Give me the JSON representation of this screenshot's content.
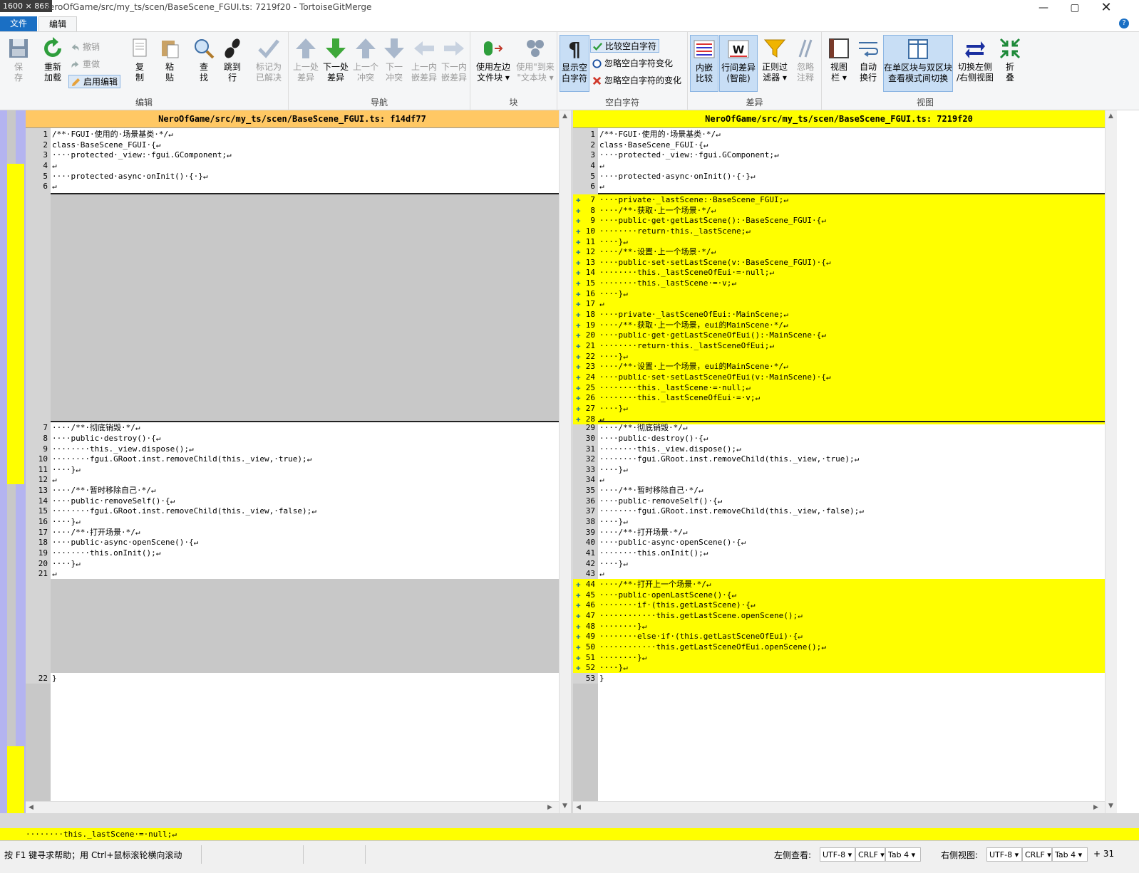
{
  "window": {
    "dimensions_label": "1600 × 868",
    "title": "NeroOfGame/src/my_ts/scen/BaseScene_FGUI.ts: 7219f20 - TortoiseGitMerge"
  },
  "ribbon_tabs": [
    "文件",
    "编辑"
  ],
  "help_label": "?",
  "ribbon": {
    "edit_group": {
      "label": "编辑",
      "save": "保\n存",
      "reload": "重新\n加载",
      "undo": "撤销",
      "redo": "重做",
      "enable_edit": "启用编辑",
      "copy": "复\n制",
      "paste": "粘\n贴",
      "find": "查\n找",
      "goto": "跳到\n行",
      "mark_resolved": "标记为\n已解决"
    },
    "nav_group": {
      "label": "导航",
      "prev_diff": "上一处\n差异",
      "next_diff": "下一处\n差异",
      "prev_conflict": "上一个\n冲突",
      "next_conflict": "下一\n冲突",
      "prev_inline": "上一内\n嵌差异",
      "next_inline": "下一内\n嵌差异"
    },
    "block_group": {
      "label": "块",
      "use_left": "使用左边\n文件块 ▾",
      "use_text": "使用\"到来\n\"文本块 ▾"
    },
    "whitespace_group": {
      "label": "空白字符",
      "show_ws": "显示空\n白字符",
      "compare_ws": "比较空白字符",
      "ignore_ws_change": "忽略空白字符变化",
      "ignore_all_ws": "忽略空白字符的变化"
    },
    "diff_group": {
      "label": "差异",
      "inline": "内嵌\n比较",
      "linediff": "行间差异\n(智能)",
      "regex": "正则过\n滤器 ▾",
      "ignore_comments": "忽略\n注释"
    },
    "view_group": {
      "label": "视图",
      "viewbar": "视图\n栏 ▾",
      "wrap": "自动\n换行",
      "switch_mode": "在单区块与双区块\n查看模式间切换",
      "swap": "切换左侧\n/右侧视图",
      "collapse": "折\n叠"
    }
  },
  "left_pane": {
    "header": "NeroOfGame/src/my_ts/scen/BaseScene_FGUI.ts: f14df77",
    "lines_top": [
      {
        "n": "1",
        "t": "/**·FGUI·使用的·场景基类·*/↵"
      },
      {
        "n": "2",
        "t": "class·BaseScene_FGUI·{↵"
      },
      {
        "n": "3",
        "t": "····protected·_view:·fgui.GComponent;↵"
      },
      {
        "n": "4",
        "t": "↵"
      },
      {
        "n": "5",
        "t": "····protected·async·onInit()·{·}↵"
      },
      {
        "n": "6",
        "t": "↵"
      }
    ],
    "lines_mid": [
      {
        "n": "7",
        "t": "····/**·彻底销毁·*/↵"
      },
      {
        "n": "8",
        "t": "····public·destroy()·{↵"
      },
      {
        "n": "9",
        "t": "········this._view.dispose();↵"
      },
      {
        "n": "10",
        "t": "········fgui.GRoot.inst.removeChild(this._view,·true);↵"
      },
      {
        "n": "11",
        "t": "····}↵"
      },
      {
        "n": "12",
        "t": "↵"
      },
      {
        "n": "13",
        "t": "····/**·暂时移除自己·*/↵"
      },
      {
        "n": "14",
        "t": "····public·removeSelf()·{↵"
      },
      {
        "n": "15",
        "t": "········fgui.GRoot.inst.removeChild(this._view,·false);↵"
      },
      {
        "n": "16",
        "t": "····}↵"
      },
      {
        "n": "17",
        "t": "····/**·打开场景·*/↵"
      },
      {
        "n": "18",
        "t": "····public·async·openScene()·{↵"
      },
      {
        "n": "19",
        "t": "········this.onInit();↵"
      },
      {
        "n": "20",
        "t": "····}↵"
      },
      {
        "n": "21",
        "t": "↵"
      }
    ],
    "lines_end": [
      {
        "n": "22",
        "t": "}"
      }
    ]
  },
  "right_pane": {
    "header": "NeroOfGame/src/my_ts/scen/BaseScene_FGUI.ts: 7219f20",
    "lines_top": [
      {
        "n": "1",
        "t": "/**·FGUI·使用的·场景基类·*/↵"
      },
      {
        "n": "2",
        "t": "class·BaseScene_FGUI·{↵"
      },
      {
        "n": "3",
        "t": "····protected·_view:·fgui.GComponent;↵"
      },
      {
        "n": "4",
        "t": "↵"
      },
      {
        "n": "5",
        "t": "····protected·async·onInit()·{·}↵"
      },
      {
        "n": "6",
        "t": "↵"
      }
    ],
    "lines_added1": [
      {
        "n": "7",
        "t": "····private·_lastScene:·BaseScene_FGUI;↵"
      },
      {
        "n": "8",
        "t": "····/**·获取·上一个场景·*/↵"
      },
      {
        "n": "9",
        "t": "····public·get·getLastScene():·BaseScene_FGUI·{↵"
      },
      {
        "n": "10",
        "t": "········return·this._lastScene;↵"
      },
      {
        "n": "11",
        "t": "····}↵"
      },
      {
        "n": "12",
        "t": "····/**·设置·上一个场景·*/↵"
      },
      {
        "n": "13",
        "t": "····public·set·setLastScene(v:·BaseScene_FGUI)·{↵"
      },
      {
        "n": "14",
        "t": "········this._lastSceneOfEui·=·null;↵"
      },
      {
        "n": "15",
        "t": "········this._lastScene·=·v;↵"
      },
      {
        "n": "16",
        "t": "····}↵"
      },
      {
        "n": "17",
        "t": "↵"
      },
      {
        "n": "18",
        "t": "····private·_lastSceneOfEui:·MainScene;↵"
      },
      {
        "n": "19",
        "t": "····/**·获取·上一个场景，eui的MainScene·*/↵"
      },
      {
        "n": "20",
        "t": "····public·get·getLastSceneOfEui():·MainScene·{↵"
      },
      {
        "n": "21",
        "t": "········return·this._lastSceneOfEui;↵"
      },
      {
        "n": "22",
        "t": "····}↵"
      },
      {
        "n": "23",
        "t": "····/**·设置·上一个场景，eui的MainScene·*/↵"
      },
      {
        "n": "24",
        "t": "····public·set·setLastSceneOfEui(v:·MainScene)·{↵"
      },
      {
        "n": "25",
        "t": "········this._lastScene·=·null;↵"
      },
      {
        "n": "26",
        "t": "········this._lastSceneOfEui·=·v;↵"
      },
      {
        "n": "27",
        "t": "····}↵"
      },
      {
        "n": "28",
        "t": "↵"
      }
    ],
    "lines_mid": [
      {
        "n": "29",
        "t": "····/**·彻底销毁·*/↵"
      },
      {
        "n": "30",
        "t": "····public·destroy()·{↵"
      },
      {
        "n": "31",
        "t": "········this._view.dispose();↵"
      },
      {
        "n": "32",
        "t": "········fgui.GRoot.inst.removeChild(this._view,·true);↵"
      },
      {
        "n": "33",
        "t": "····}↵"
      },
      {
        "n": "34",
        "t": "↵"
      },
      {
        "n": "35",
        "t": "····/**·暂时移除自己·*/↵"
      },
      {
        "n": "36",
        "t": "····public·removeSelf()·{↵"
      },
      {
        "n": "37",
        "t": "········fgui.GRoot.inst.removeChild(this._view,·false);↵"
      },
      {
        "n": "38",
        "t": "····}↵"
      },
      {
        "n": "39",
        "t": "····/**·打开场景·*/↵"
      },
      {
        "n": "40",
        "t": "····public·async·openScene()·{↵"
      },
      {
        "n": "41",
        "t": "········this.onInit();↵"
      },
      {
        "n": "42",
        "t": "····}↵"
      },
      {
        "n": "43",
        "t": "↵"
      }
    ],
    "lines_added2": [
      {
        "n": "44",
        "t": "····/**·打开上一个场景·*/↵"
      },
      {
        "n": "45",
        "t": "····public·openLastScene()·{↵"
      },
      {
        "n": "46",
        "t": "········if·(this.getLastScene)·{↵"
      },
      {
        "n": "47",
        "t": "············this.getLastScene.openScene();↵"
      },
      {
        "n": "48",
        "t": "········}↵"
      },
      {
        "n": "49",
        "t": "········else·if·(this.getLastSceneOfEui)·{↵"
      },
      {
        "n": "50",
        "t": "············this.getLastSceneOfEui.openScene();↵"
      },
      {
        "n": "51",
        "t": "········}↵"
      },
      {
        "n": "52",
        "t": "····}↵"
      }
    ],
    "lines_end": [
      {
        "n": "53",
        "t": "}"
      }
    ]
  },
  "detail_line": "········this._lastScene·=·null;↵",
  "status": {
    "help": "按 F1 键寻求帮助；用 Ctrl+鼠标滚轮横向滚动",
    "left_view_label": "左侧查看:",
    "left_encoding": "UTF-8",
    "left_eol": "CRLF",
    "left_tab": "Tab 4",
    "right_view_label": "右侧视图:",
    "right_encoding": "UTF-8",
    "right_eol": "CRLF",
    "right_tab": "Tab 4",
    "right_extra": "+ 31"
  },
  "colors": {
    "added": "#ffff00",
    "removed_placeholder": "#c8c8c8",
    "left_header": "#ffc864",
    "right_header": "#ffff00",
    "gutter_purple": "#b4b4f0",
    "accent_blue": "#1a6fc4"
  },
  "icons": [
    "save-icon",
    "reload-icon",
    "undo-icon",
    "redo-icon",
    "edit-icon",
    "copy-icon",
    "paste-icon",
    "search-icon",
    "goto-icon",
    "check-icon",
    "arrow-up-icon",
    "arrow-down-icon",
    "block-left-icon",
    "block-text-icon",
    "pilcrow-icon",
    "checkbox-icon",
    "radio-icon",
    "x-icon",
    "inline-diff-icon",
    "word-diff-icon",
    "filter-icon",
    "comment-icon",
    "viewbar-icon",
    "wrap-icon",
    "split-view-icon",
    "swap-icon",
    "collapse-icon"
  ]
}
